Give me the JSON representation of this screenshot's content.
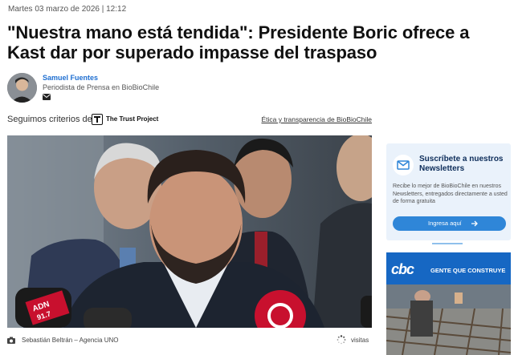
{
  "article": {
    "date": "Martes 03 marzo de 2026 | 12:12",
    "headline": "\"Nuestra mano está tendida\": Presidente Boric ofrece a Kast dar por superado impasse del traspaso"
  },
  "author": {
    "name": "Samuel Fuentes",
    "role": "Periodista de Prensa en BioBioChile"
  },
  "trust": {
    "intro": "Seguimos criterios de",
    "project_name": "The Trust Project",
    "ethics_link": "Ética y transparencia de BioBioChile"
  },
  "photo": {
    "credit": "Sebastián Beltrán – Agencia UNO",
    "views_label": "visitas",
    "mic_text_1": "ADN",
    "mic_text_2": "91.7"
  },
  "newsletter": {
    "title": "Suscríbete a nuestros Newsletters",
    "description": "Recibe lo mejor de BioBioChile en nuestros Newsletters, entregados directamente a usted de forma gratuita",
    "button_label": "Ingresa aquí"
  },
  "ad": {
    "logo": "cbc",
    "text": "GENTE QUE CONSTRUYE"
  },
  "colors": {
    "accent_blue": "#1f6fd1",
    "newsletter_bg": "#eaf2fb",
    "button_blue": "#2f86d8",
    "ad_blue": "#1667c3"
  }
}
